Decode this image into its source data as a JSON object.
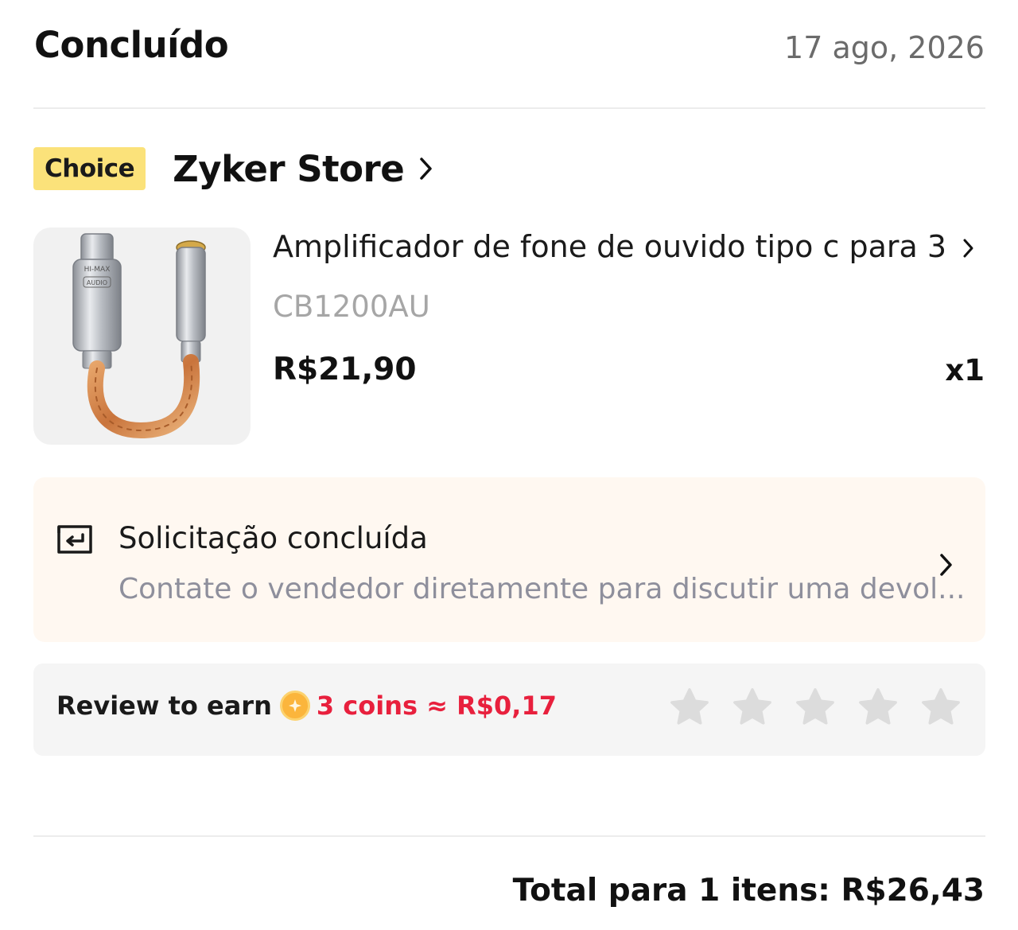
{
  "header": {
    "status": "Concluído",
    "date": "17 ago, 2026"
  },
  "store": {
    "badge": "Choice",
    "name": "Zyker Store"
  },
  "product": {
    "title": "Amplificador de fone de ouvido tipo c para 3...",
    "sku": "CB1200AU",
    "price": "R$21,90",
    "quantity": "x1",
    "image_icon": "usb-c-to-3.5mm-adapter-image",
    "image_text": {
      "brand": "HI-MAX",
      "sub": "AUDIO"
    }
  },
  "request": {
    "icon": "return-icon",
    "title": "Solicitação concluída",
    "description": "Contate o vendedor diretamente para discutir uma devol..."
  },
  "review": {
    "label": "Review to earn",
    "coins": "3 coins ≈ R$0,17",
    "stars_count": 5,
    "star_color": "#dcdcdc",
    "accent_color": "#e8203d"
  },
  "total": {
    "text": "Total para 1 itens: R$26,43"
  },
  "colors": {
    "choice_badge": "#fbe27a",
    "request_bg": "#fff8f1",
    "review_bg": "#f5f5f5"
  }
}
